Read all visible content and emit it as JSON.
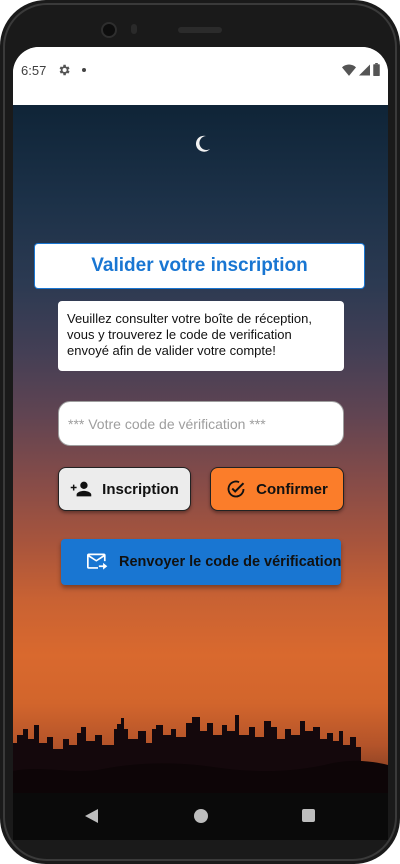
{
  "status_bar": {
    "time": "6:57",
    "settings_icon": "gear-icon",
    "wifi_icon": "wifi-icon",
    "signal_icon": "signal-icon",
    "battery_icon": "battery-icon"
  },
  "page": {
    "title": "Valider votre inscription",
    "info_text": "Veuillez consulter votre boîte de réception, vous y trouverez le code de verification envoyé afin de valider votre compte!",
    "code_input": {
      "placeholder": "*** Votre code de vérification ***",
      "value": ""
    },
    "buttons": {
      "inscription_label": "Inscription",
      "inscription_icon": "person-add-icon",
      "confirm_label": "Confirmer",
      "confirm_icon": "check-circle-icon",
      "resend_label": "Renvoyer le code de vérification",
      "resend_icon": "mail-forward-icon"
    }
  },
  "nav_bar": {
    "back_icon": "back-triangle-icon",
    "home_icon": "home-circle-icon",
    "recents_icon": "recents-square-icon"
  },
  "colors": {
    "accent_blue": "#1976d2",
    "confirm_orange": "#fb7d2a",
    "inscription_gray": "#ececec"
  }
}
